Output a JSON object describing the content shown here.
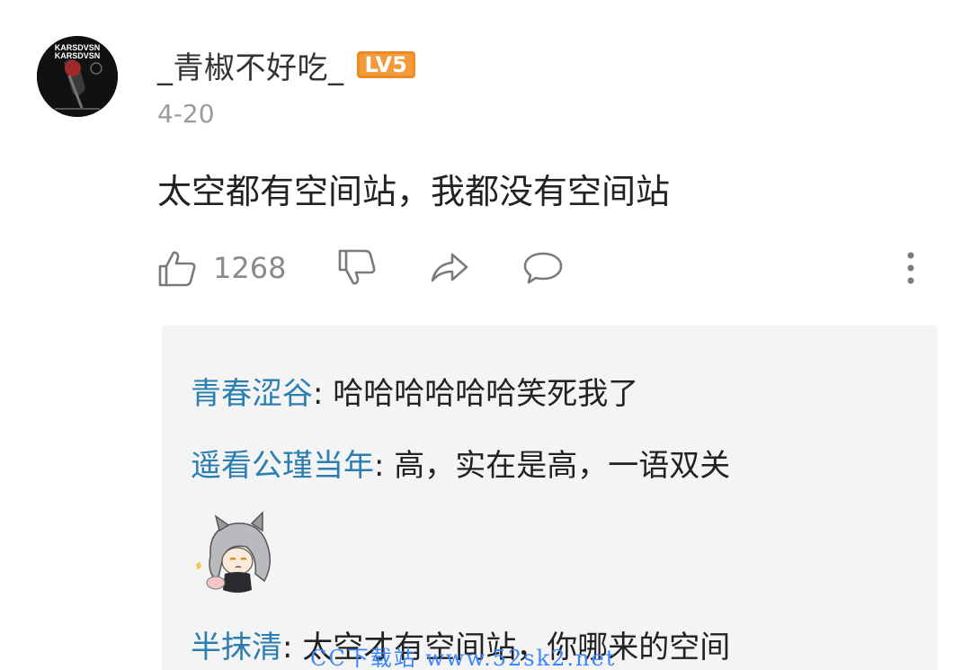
{
  "comment": {
    "username": "_青椒不好吃_",
    "level_badge": "LV5",
    "date": "4-20",
    "text": "太空都有空间站，我都没有空间站",
    "like_count": "1268"
  },
  "actions": {
    "like_icon": "thumbs-up-icon",
    "dislike_icon": "thumbs-down-icon",
    "share_icon": "share-arrow-icon",
    "comment_icon": "comment-bubble-icon",
    "more_icon": "more-vertical-icon"
  },
  "avatar": {
    "text_1": "KARSDVSN",
    "text_2": "KARSDVSN"
  },
  "replies": [
    {
      "author": "青春涩谷",
      "separator": ":",
      "text": " 哈哈哈哈哈哈笑死我了"
    },
    {
      "author": "遥看公瑾当年",
      "separator": ":",
      "text": " 高，实在是高，一语双关"
    },
    {
      "author": "半抹清",
      "separator": ":",
      "text": " 太空才有空间站，你哪来的空间"
    }
  ],
  "sticker": {
    "icon": "anime-cat-girl-sticker"
  },
  "watermark": {
    "text": "CC下载站 www.52sk2.net"
  },
  "colors": {
    "reply_author": "#2a7fb0",
    "badge": "#f39b3a",
    "reply_background": "#f4f4f4"
  }
}
